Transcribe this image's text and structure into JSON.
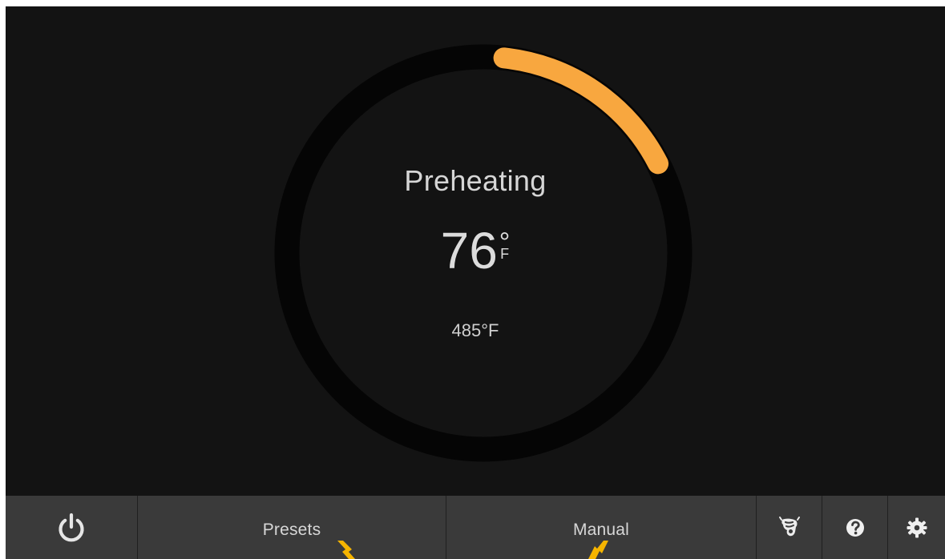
{
  "gauge": {
    "status": "Preheating",
    "current_temp": "76",
    "degree_symbol": "°",
    "unit": "F",
    "target_temp": "485°F",
    "progress_fraction": 0.158,
    "colors": {
      "track": "#050505",
      "progress": "#f8a73f",
      "background": "#131313"
    }
  },
  "bottom_bar": {
    "presets_label": "Presets",
    "manual_label": "Manual",
    "icons": {
      "power": "power-icon",
      "probe": "probe-icon",
      "help": "help-icon",
      "settings": "gear-icon"
    }
  },
  "annotations": {
    "arrow_color": "#f5b400"
  }
}
